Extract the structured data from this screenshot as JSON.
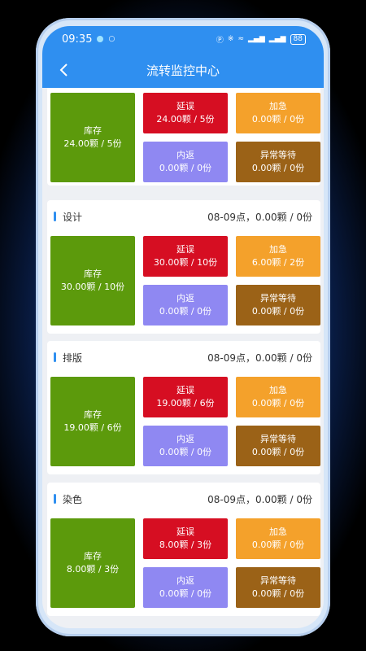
{
  "status": {
    "time": "09:35",
    "battery": "88"
  },
  "header": {
    "title": "流转监控中心"
  },
  "labels": {
    "stock": "库存",
    "delay": "延误",
    "urgent": "加急",
    "return": "内返",
    "abnormal": "异常等待"
  },
  "sections": [
    {
      "name": "",
      "summary": "",
      "stock": "24.00颗 / 5份",
      "delay": "24.00颗 / 5份",
      "urgent": "0.00颗 / 0份",
      "return": "0.00颗 / 0份",
      "abnormal": "0.00颗 / 0份"
    },
    {
      "name": "设计",
      "summary": "08-09点，0.00颗 / 0份",
      "stock": "30.00颗 / 10份",
      "delay": "30.00颗 / 10份",
      "urgent": "6.00颗 / 2份",
      "return": "0.00颗 / 0份",
      "abnormal": "0.00颗 / 0份"
    },
    {
      "name": "排版",
      "summary": "08-09点，0.00颗 / 0份",
      "stock": "19.00颗 / 6份",
      "delay": "19.00颗 / 6份",
      "urgent": "0.00颗 / 0份",
      "return": "0.00颗 / 0份",
      "abnormal": "0.00颗 / 0份"
    },
    {
      "name": "染色",
      "summary": "08-09点，0.00颗 / 0份",
      "stock": "8.00颗 / 3份",
      "delay": "8.00颗 / 3份",
      "urgent": "0.00颗 / 0份",
      "return": "0.00颗 / 0份",
      "abnormal": "0.00颗 / 0份"
    }
  ],
  "colors": {
    "primary": "#2f8ff0",
    "stock": "#5c9a0c",
    "delay": "#d60e22",
    "urgent": "#f4a12b",
    "return": "#8f88f2",
    "abnormal": "#9b6217"
  },
  "icons": {
    "back": "back-arrow-icon",
    "status": [
      "notification-icon",
      "nfc-icon",
      "bluetooth-icon",
      "wifi-icon",
      "signal-icon",
      "battery-icon"
    ]
  }
}
